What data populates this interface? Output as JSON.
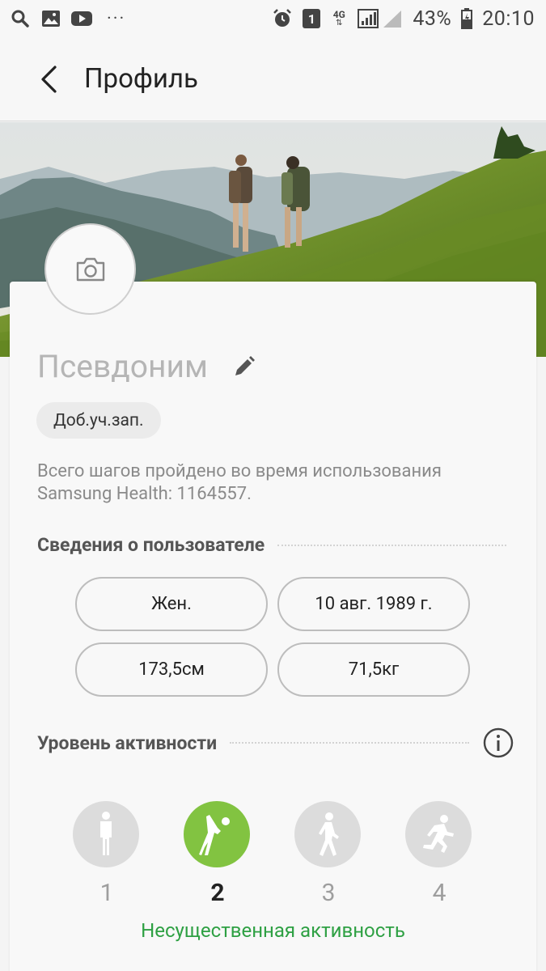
{
  "status_bar": {
    "left_icons": [
      "search-icon",
      "image-icon",
      "youtube-icon"
    ],
    "more": "···",
    "right_icons": [
      "alarm-icon",
      "sim-icon",
      "network-4g-icon",
      "signal-icon"
    ],
    "sim_label": "1",
    "network_label": "4G",
    "battery": "43%",
    "time": "20:10"
  },
  "app_bar": {
    "title": "Профиль"
  },
  "profile": {
    "nickname": "Псевдоним",
    "add_account": "Доб.уч.зап.",
    "steps_text": "Всего шагов пройдено во время использования Samsung Health: 1164557."
  },
  "user_info": {
    "title": "Сведения о пользователе",
    "gender": "Жен.",
    "birthday": "10 авг. 1989 г.",
    "height": "173,5см",
    "weight": "71,5кг"
  },
  "activity": {
    "title": "Уровень активности",
    "levels": [
      {
        "num": "1",
        "icon": "standing-person-icon"
      },
      {
        "num": "2",
        "icon": "stretching-person-icon"
      },
      {
        "num": "3",
        "icon": "walking-person-icon"
      },
      {
        "num": "4",
        "icon": "running-person-icon"
      }
    ],
    "selected_level": 2,
    "selected_label": "Несущественная активность",
    "accent_color": "#82c341",
    "label_color": "#2ea043"
  }
}
